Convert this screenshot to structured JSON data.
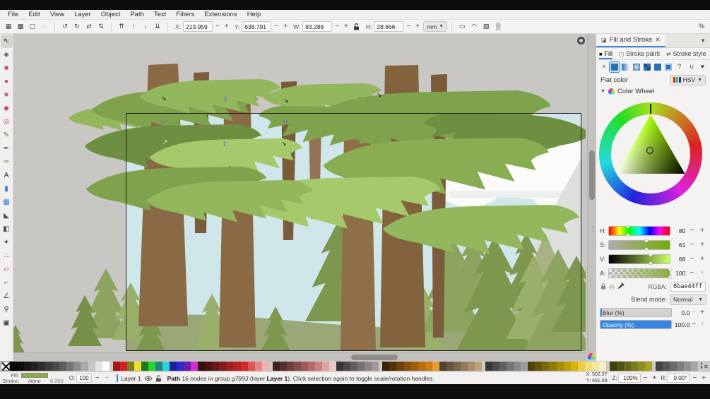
{
  "menu": {
    "items": [
      "File",
      "Edit",
      "View",
      "Layer",
      "Object",
      "Path",
      "Text",
      "Filters",
      "Extensions",
      "Help"
    ]
  },
  "toolbar": {
    "select_group": [
      {
        "name": "select-all",
        "glyph": "▦"
      },
      {
        "name": "select-all-layers",
        "glyph": "▩"
      },
      {
        "name": "deselect",
        "glyph": "▢"
      },
      {
        "name": "selection-touch",
        "glyph": "◌"
      }
    ],
    "rotate_group": [
      {
        "name": "rotate-ccw",
        "glyph": "↺"
      },
      {
        "name": "rotate-cw",
        "glyph": "↻"
      },
      {
        "name": "flip-horizontal",
        "glyph": "⇄"
      },
      {
        "name": "flip-vertical",
        "glyph": "⇅"
      }
    ],
    "order_group": [
      {
        "name": "raise-to-top",
        "glyph": "⇈"
      },
      {
        "name": "raise",
        "glyph": "↑"
      },
      {
        "name": "lower",
        "glyph": "↓"
      },
      {
        "name": "lower-to-bottom",
        "glyph": "⇊"
      }
    ],
    "fields": [
      {
        "name": "x-field",
        "label": "X:",
        "value": "213.959"
      },
      {
        "name": "y-field",
        "label": "Y:",
        "value": "638.791"
      },
      {
        "name": "w-field",
        "label": "W:",
        "value": "83.286"
      },
      {
        "name": "h-field",
        "label": "H:",
        "value": "28.666"
      }
    ],
    "units": "mm",
    "affect_group": [
      {
        "name": "scale-stroke-toggle",
        "glyph": "▭"
      },
      {
        "name": "scale-corners-toggle",
        "glyph": "◠"
      },
      {
        "name": "scale-gradients-toggle",
        "glyph": "▨"
      },
      {
        "name": "scale-patterns-toggle",
        "glyph": "▒"
      }
    ],
    "snap_label": "%"
  },
  "toolbox": {
    "tools": [
      {
        "name": "select-tool",
        "glyph": "↖",
        "color": "#2e2e2e",
        "active": true
      },
      {
        "name": "node-tool",
        "glyph": "◈",
        "color": "#4a4a4a"
      },
      {
        "name": "rect-tool",
        "glyph": "■",
        "color": "#c4407e"
      },
      {
        "name": "ellipse-tool",
        "glyph": "●",
        "color": "#c4407e"
      },
      {
        "name": "star-tool",
        "glyph": "★",
        "color": "#c4407e"
      },
      {
        "name": "box3d-tool",
        "glyph": "◆",
        "color": "#c4407e"
      },
      {
        "name": "spiral-tool",
        "glyph": "◎",
        "color": "#c4407e"
      },
      {
        "name": "pencil-tool",
        "glyph": "✎",
        "color": "#3d8a3d"
      },
      {
        "name": "pen-tool",
        "glyph": "✒",
        "color": "#3d8a3d"
      },
      {
        "name": "calligraphy-tool",
        "glyph": "✑",
        "color": "#3d8a3d"
      },
      {
        "name": "text-tool",
        "glyph": "A",
        "color": "#2e2e2e"
      },
      {
        "name": "gradient-tool",
        "glyph": "▮",
        "color": "#3a7bd5"
      },
      {
        "name": "mesh-tool",
        "glyph": "▦",
        "color": "#3a7bd5"
      },
      {
        "name": "dropper-tool",
        "glyph": "◣",
        "color": "#4a4a4a"
      },
      {
        "name": "bucket-tool",
        "glyph": "◧",
        "color": "#4a4a4a"
      },
      {
        "name": "tweak-tool",
        "glyph": "✦",
        "color": "#4a4a4a"
      },
      {
        "name": "spray-tool",
        "glyph": "∴",
        "color": "#4a4a4a"
      },
      {
        "name": "eraser-tool",
        "glyph": "▱",
        "color": "#c4407e"
      },
      {
        "name": "connector-tool",
        "glyph": "⌐",
        "color": "#4a4a4a"
      },
      {
        "name": "measure-tool",
        "glyph": "∠",
        "color": "#4a4a4a"
      },
      {
        "name": "zoom-tool",
        "glyph": "⚲",
        "color": "#2e2e2e"
      },
      {
        "name": "pages-tool",
        "glyph": "▣",
        "color": "#4a4a4a"
      }
    ]
  },
  "dock": {
    "tab_title": "Fill and Stroke",
    "tabs": [
      {
        "name": "tab-fill",
        "label": "Fill",
        "icon": "■",
        "active": true
      },
      {
        "name": "tab-stroke-paint",
        "label": "Stroke paint",
        "icon": "▢",
        "active": false
      },
      {
        "name": "tab-stroke-style",
        "label": "Stroke style",
        "icon": "⇄",
        "active": false
      }
    ],
    "paint_buttons": [
      {
        "name": "paint-none",
        "kind": "none",
        "glyph": "×"
      },
      {
        "name": "paint-flat",
        "kind": "flat",
        "active": true
      },
      {
        "name": "paint-linear-gradient",
        "kind": "linear"
      },
      {
        "name": "paint-radial-gradient",
        "kind": "radial"
      },
      {
        "name": "paint-pattern",
        "kind": "pattern"
      },
      {
        "name": "paint-mesh-gradient",
        "kind": "mesh"
      },
      {
        "name": "paint-swatch",
        "kind": "swatch"
      },
      {
        "name": "paint-unknown",
        "kind": "unknown",
        "glyph": "?"
      }
    ],
    "fillrule_buttons": [
      {
        "name": "fill-rule-evenodd",
        "kind": "evenodd",
        "glyph": "∪"
      },
      {
        "name": "fill-rule-nonzero",
        "kind": "nonzero",
        "glyph": "♥"
      }
    ],
    "paint_label": "Flat color",
    "picker_mode": "HSV",
    "wheel_label": "Color Wheel",
    "sliders": [
      {
        "key": "H",
        "label": "H:",
        "value": "80",
        "pos": 31,
        "plus_enabled": true
      },
      {
        "key": "S",
        "label": "S:",
        "value": "61",
        "pos": 61,
        "plus_enabled": true
      },
      {
        "key": "V",
        "label": "V:",
        "value": "68",
        "pos": 68,
        "plus_enabled": true
      },
      {
        "key": "A",
        "label": "A:",
        "value": "100",
        "pos": 100,
        "plus_enabled": false
      }
    ],
    "rgba_label": "RGBA:",
    "rgba_value": "8bae44ff",
    "blend_label": "Blend mode:",
    "blend_value": "Normal",
    "blur_label": "Blur (%)",
    "blur_value": "0.0",
    "opacity_label": "Opacity (%)",
    "opacity_value": "100.0",
    "accent_color": "#3584e4",
    "current_color": "#8bae44"
  },
  "palette": {
    "colors": [
      "#000000",
      "#0b0b0b",
      "#161616",
      "#222222",
      "#2e2e2e",
      "#3b3b3b",
      "#4a4a4a",
      "#5e5e5e",
      "#757575",
      "#8f8f8f",
      "#ababab",
      "#c6c6c6",
      "#e3e3e3",
      "#ffffff",
      "GAP",
      "#9e1b1b",
      "#d42222",
      "#7d7d1f",
      "#f0e02a",
      "#1d7a1d",
      "#2ad42a",
      "#1f8585",
      "#2ad4d4",
      "#1f1f99",
      "#2a2ad4",
      "#6b1fa8",
      "#d42ad4",
      "#330f0f",
      "#4d1313",
      "#671818",
      "#821c1c",
      "#9c2121",
      "#b62525",
      "#d02a2a",
      "#dd5555",
      "#e78383",
      "#f1b1b1",
      "GAP",
      "#3d2222",
      "#553030",
      "#6d3e3e",
      "#854c4c",
      "#9d5a5a",
      "#b56868",
      "#cd8181",
      "#dda4a4",
      "#edc8c8",
      "#3a3434",
      "#4f4848",
      "#645c5c",
      "#797070",
      "#8e8484",
      "#a39898",
      "GAP",
      "#3d2408",
      "#553309",
      "#6d420b",
      "#85510c",
      "#9d600e",
      "#b56f10",
      "#cd7e12",
      "#e59b33",
      "#4f4130",
      "#65543e",
      "#7b674c",
      "#917a5a",
      "#a78d68",
      "#bda076",
      "GAP",
      "#383838",
      "#4c4c4c",
      "#606060",
      "#747474",
      "#888888",
      "#9c9c9c",
      "#4f4208",
      "#655508",
      "#7b6808",
      "#917b08",
      "#a78e08",
      "#bda108",
      "#d3b408",
      "#e9cf40",
      "#f0dc7a",
      "#f5e5a0",
      "#f9eec6",
      "GAP",
      "#3f3f10",
      "#535314",
      "#676718",
      "#7b7b1c",
      "#8f8f20",
      "#a3a324",
      "GAP",
      "#424242",
      "#565656",
      "#6a6a6a",
      "#7e7e7e",
      "#929292",
      "#a6a6a6"
    ]
  },
  "statusbar": {
    "fill_label": "Fill:",
    "fill_color": "#8bae44",
    "stroke_label": "Stroke:",
    "stroke_value": "None",
    "stroke_width": "0.265",
    "opacity_label": "O:",
    "opacity_value": "100",
    "layer_name": "Layer 1",
    "message": {
      "b1": "Path",
      "t1": " 16 nodes in group ",
      "i1": "g7893",
      "t2": " (layer ",
      "b2": "Layer 1",
      "t3": "). Click selection again to toggle scale/rotation handles."
    },
    "x_label": "X:",
    "x_value": "502.97",
    "y_label": "Y:",
    "y_value": "691.89",
    "z_label": "Z:",
    "z_value": "100%",
    "r_label": "R:",
    "r_value": "0.00°"
  }
}
